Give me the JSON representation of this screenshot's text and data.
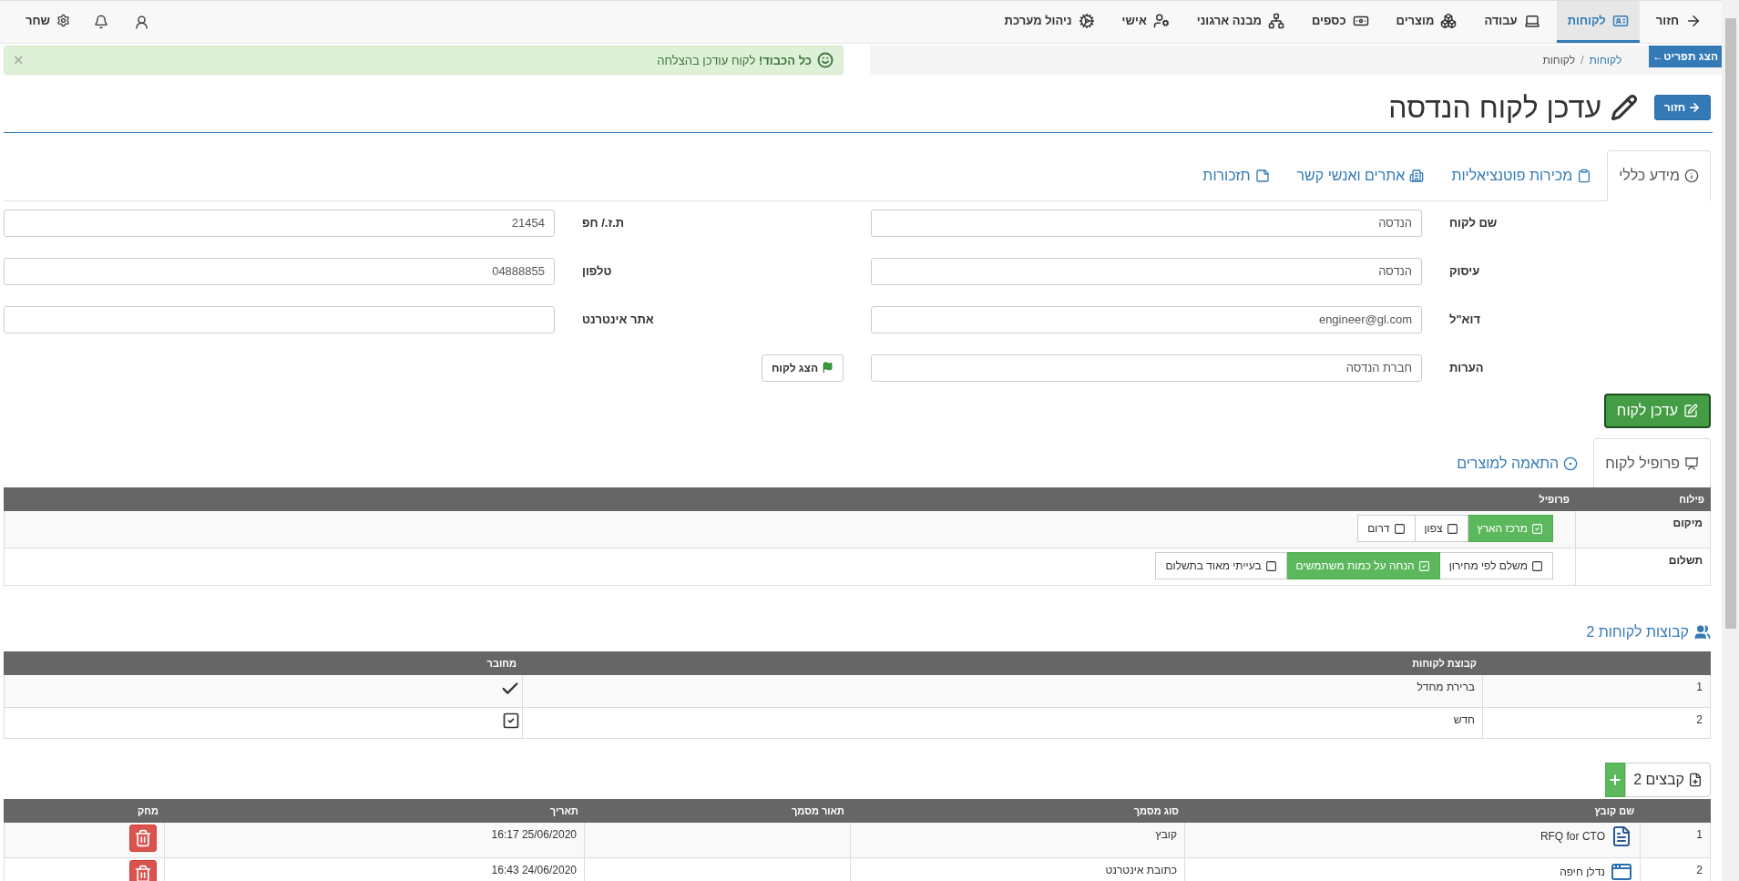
{
  "nav": {
    "items": [
      {
        "label": "חזור",
        "kind": "arrow",
        "selected": false
      },
      {
        "label": "לקוחות",
        "kind": "card",
        "selected": true
      },
      {
        "label": "עבודה",
        "kind": "laptop",
        "selected": false
      },
      {
        "label": "מוצרים",
        "kind": "boxes",
        "selected": false
      },
      {
        "label": "כספים",
        "kind": "money",
        "selected": false
      },
      {
        "label": "מבנה ארגוני",
        "kind": "sitemap",
        "selected": false
      },
      {
        "label": "אישי",
        "kind": "user",
        "selected": false
      },
      {
        "label": "ניהול מערכת",
        "kind": "cogs",
        "selected": false
      }
    ],
    "user": "שחר"
  },
  "menu_toggle": "הצג תפריט←",
  "breadcrumb": {
    "items": [
      "לקוחות",
      "לקוחות"
    ],
    "separator": "/"
  },
  "alert": {
    "text": "**כל הכבוד!** לקוח עודכן בהצלחה",
    "close": "×"
  },
  "back_button": "חזור",
  "title": "עדכן לקוח הנדסה",
  "tabs": [
    {
      "label": "מידע כללי",
      "kind": "info",
      "selected": true
    },
    {
      "label": "מכירות פוטנציאליות",
      "kind": "clipboard",
      "selected": false
    },
    {
      "label": "אתרים ואנשי קשר",
      "kind": "building",
      "selected": false
    },
    {
      "label": "תזכורות",
      "kind": "note",
      "selected": false
    }
  ],
  "form": {
    "right": [
      {
        "label": "שם לקוח",
        "value": "הנדסה"
      },
      {
        "label": "עיסוק",
        "value": "הנדסה"
      },
      {
        "label": "דוא\"ל",
        "value": "engineer@gl.com"
      },
      {
        "label": "הערות",
        "value": "חברת הנדסה"
      }
    ],
    "left": [
      {
        "label": "ת.ז./ חפ",
        "value": "21454"
      },
      {
        "label": "טלפון",
        "value": "04888855"
      },
      {
        "label": "אתר אינטרנט"
      }
    ],
    "show_customer": "הצג לקוח",
    "submit": "עדכן לקוח"
  },
  "profile_tabs": [
    {
      "label": "פרופיל לקוח",
      "kind": "presentation",
      "selected": true
    },
    {
      "label": "התאמה למוצרים",
      "kind": "target",
      "selected": false
    }
  ],
  "profile_table": {
    "columns": [
      "פילוח",
      "פרופיל"
    ],
    "rows": [
      {
        "segment": "מיקום",
        "options": [
          {
            "label": "מרכז הארץ",
            "checked": true
          },
          {
            "label": "צפון",
            "checked": false
          },
          {
            "label": "דרום",
            "checked": false
          }
        ]
      },
      {
        "segment": "תשלום",
        "options": [
          {
            "label": "משלם לפי מחירון",
            "checked": false
          },
          {
            "label": "הנחה על כמות משתמשים",
            "checked": true
          },
          {
            "label": "בעייתי מאוד בתשלום",
            "checked": false
          }
        ]
      }
    ]
  },
  "groups": {
    "title": "קבוצות לקוחות 2",
    "columns": [
      "קבוצת לקוחות",
      "מחובר"
    ],
    "rows": [
      {
        "index": "1",
        "name": "ברירת מחדל",
        "kind": "tick"
      },
      {
        "index": "2",
        "name": "חדש",
        "kind": "checkbox"
      }
    ]
  },
  "files": {
    "button": "קבצים 2",
    "columns": [
      "שם קובץ",
      "סוג מסמך",
      "תאור מסמך",
      "תאריך",
      "מחק"
    ],
    "rows": [
      {
        "index": "1",
        "kind": "word",
        "name": "RFQ for CTO",
        "type": "קובץ",
        "date": "25/06/2020 16:17"
      },
      {
        "index": "2",
        "kind": "web",
        "name": "נדלן חיפה",
        "type": "כתובת אינטרנט",
        "date": "24/06/2020 16:43"
      }
    ]
  }
}
